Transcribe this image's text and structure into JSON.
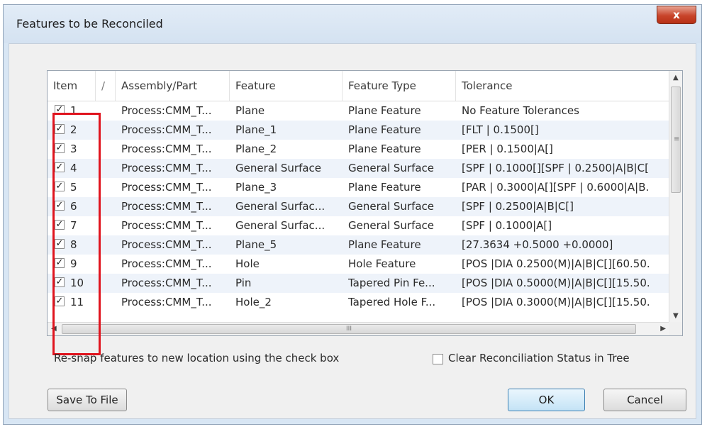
{
  "window": {
    "title": "Features to be Reconciled",
    "close_glyph": "x"
  },
  "grid": {
    "headers": {
      "item": "Item",
      "sort": "/",
      "assembly": "Assembly/Part",
      "feature": "Feature",
      "type": "Feature Type",
      "tolerance": "Tolerance"
    },
    "rows": [
      {
        "item": "1",
        "checked": true,
        "assembly": "Process:CMM_T...",
        "feature": "Plane",
        "type": "Plane Feature",
        "tolerance": "No Feature Tolerances"
      },
      {
        "item": "2",
        "checked": true,
        "assembly": "Process:CMM_T...",
        "feature": "Plane_1",
        "type": "Plane Feature",
        "tolerance": "[FLT | 0.1500[]"
      },
      {
        "item": "3",
        "checked": true,
        "assembly": "Process:CMM_T...",
        "feature": "Plane_2",
        "type": "Plane Feature",
        "tolerance": "[PER | 0.1500|A[]"
      },
      {
        "item": "4",
        "checked": true,
        "assembly": "Process:CMM_T...",
        "feature": "General Surface",
        "type": "General Surface",
        "tolerance": "[SPF | 0.1000[][SPF | 0.2500|A|B|C["
      },
      {
        "item": "5",
        "checked": true,
        "assembly": "Process:CMM_T...",
        "feature": "Plane_3",
        "type": "Plane Feature",
        "tolerance": "[PAR | 0.3000|A[][SPF | 0.6000|A|B."
      },
      {
        "item": "6",
        "checked": true,
        "assembly": "Process:CMM_T...",
        "feature": "General Surfac...",
        "type": "General Surface",
        "tolerance": "[SPF | 0.2500|A|B|C[]"
      },
      {
        "item": "7",
        "checked": true,
        "assembly": "Process:CMM_T...",
        "feature": "General Surfac...",
        "type": "General Surface",
        "tolerance": "[SPF | 0.1000|A[]"
      },
      {
        "item": "8",
        "checked": true,
        "assembly": "Process:CMM_T...",
        "feature": "Plane_5",
        "type": "Plane Feature",
        "tolerance": "[27.3634 +0.5000 +0.0000]"
      },
      {
        "item": "9",
        "checked": true,
        "assembly": "Process:CMM_T...",
        "feature": "Hole",
        "type": "Hole Feature",
        "tolerance": "[POS |DIA 0.2500(M)|A|B|C[][60.50."
      },
      {
        "item": "10",
        "checked": true,
        "assembly": "Process:CMM_T...",
        "feature": "Pin",
        "type": "Tapered Pin Fe...",
        "tolerance": "[POS |DIA 0.5000(M)|A|B|C[][15.50."
      },
      {
        "item": "11",
        "checked": true,
        "assembly": "Process:CMM_T...",
        "feature": "Hole_2",
        "type": "Tapered Hole F...",
        "tolerance": "[POS |DIA 0.3000(M)|A|B|C[][15.50."
      }
    ],
    "check_glyph": "✓",
    "vscroll": {
      "up": "▲",
      "down": "▼",
      "grip": "≡"
    },
    "hscroll": {
      "left": "◀",
      "right": "▶",
      "grip": "III"
    }
  },
  "info_text": "Re-snap features to new location using the check box",
  "clear_option": {
    "label": "Clear Reconciliation Status in Tree",
    "checked": false
  },
  "buttons": {
    "save": "Save To File",
    "ok": "OK",
    "cancel": "Cancel"
  },
  "colors": {
    "highlight": "#e0141e",
    "alt_row": "#eef3fa",
    "ok_border": "#3c7fb1"
  }
}
